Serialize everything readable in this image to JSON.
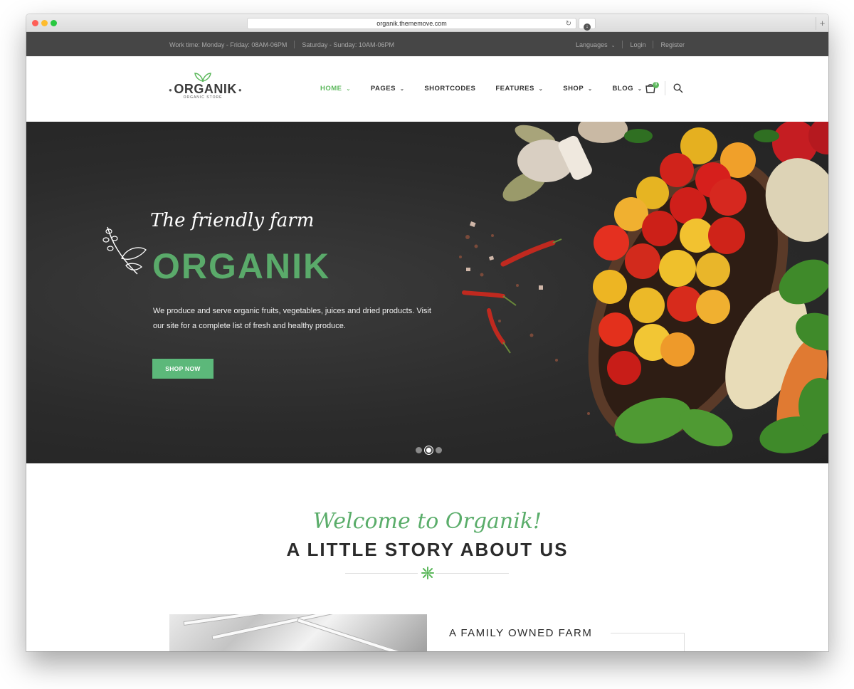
{
  "browser": {
    "url": "organik.thememove.com",
    "reload_icon": "reload-icon",
    "download_icon": "download-icon",
    "new_tab_icon": "plus-icon"
  },
  "topbar": {
    "work_time": "Work time: Monday - Friday: 08AM-06PM",
    "weekend_time": "Saturday - Sunday: 10AM-06PM",
    "languages": "Languages",
    "login": "Login",
    "register": "Register"
  },
  "logo": {
    "brand": "ORGANIK",
    "sub": "ORGANIC STORE"
  },
  "nav": {
    "items": [
      {
        "label": "HOME",
        "active": true,
        "dropdown": true
      },
      {
        "label": "PAGES",
        "active": false,
        "dropdown": true
      },
      {
        "label": "SHORTCODES",
        "active": false,
        "dropdown": false
      },
      {
        "label": "FEATURES",
        "active": false,
        "dropdown": true
      },
      {
        "label": "SHOP",
        "active": false,
        "dropdown": true
      },
      {
        "label": "BLOG",
        "active": false,
        "dropdown": true
      }
    ],
    "cart_count": "0"
  },
  "hero": {
    "tagline": "The friendly farm",
    "title": "ORGANIK",
    "description": "We produce and serve organic fruits, vegetables, juices and dried products. Visit our site for a complete list of fresh and healthy produce.",
    "cta": "SHOP NOW",
    "slides_total": 3,
    "active_slide": 2
  },
  "welcome": {
    "script": "Welcome to Organik!",
    "heading": "A LITTLE STORY ABOUT US",
    "farm_title": "A FAMILY OWNED FARM"
  },
  "colors": {
    "accent_green": "#5cb85c",
    "topbar_bg": "#464646",
    "hero_bg": "#2b2b2b"
  }
}
